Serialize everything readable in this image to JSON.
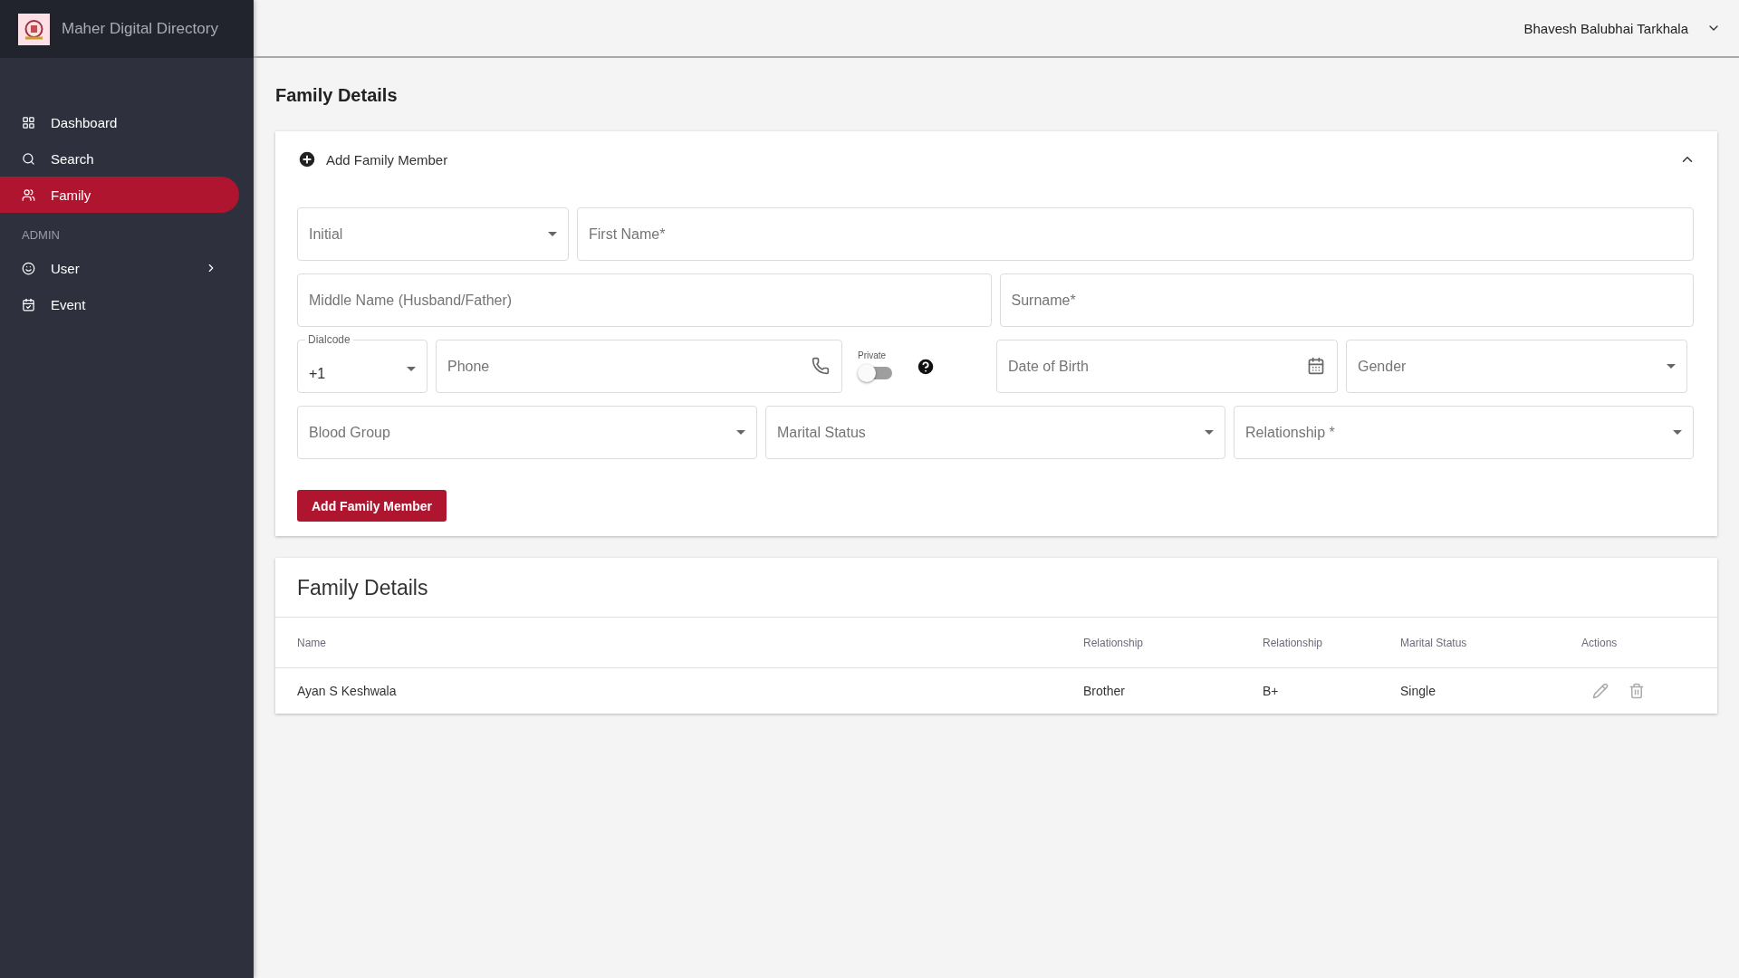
{
  "app": {
    "title": "Maher Digital Directory"
  },
  "sidebar": {
    "items": [
      {
        "label": "Dashboard",
        "selected": false
      },
      {
        "label": "Search",
        "selected": false
      },
      {
        "label": "Family",
        "selected": true
      }
    ],
    "section": "ADMIN",
    "admin_items": [
      {
        "label": "User",
        "selected": false,
        "has_submenu": true
      },
      {
        "label": "Event",
        "selected": false,
        "has_submenu": false
      }
    ]
  },
  "header": {
    "user": "Bhavesh Balubhai Tarkhala"
  },
  "page_title": "Family Details",
  "form": {
    "title": "Add Family Member",
    "expanded": true,
    "fields": [
      {
        "kind": "select",
        "placeholder": "Initial"
      },
      {
        "kind": "text",
        "placeholder": "First Name*"
      },
      {
        "kind": "text",
        "placeholder": "Middle Name (Husband/Father)"
      },
      {
        "kind": "text",
        "placeholder": "Surname*"
      },
      {
        "kind": "dialcode",
        "label": "Dialcode",
        "value": "+1"
      },
      {
        "kind": "phone",
        "placeholder": "Phone"
      },
      {
        "kind": "toggle",
        "label": "Private",
        "on": false
      },
      {
        "kind": "date",
        "placeholder": "Date of Birth"
      },
      {
        "kind": "select",
        "placeholder": "Gender"
      },
      {
        "kind": "select",
        "placeholder": "Blood Group"
      },
      {
        "kind": "select",
        "placeholder": "Marital Status"
      },
      {
        "kind": "select",
        "placeholder": "Relationship *"
      }
    ],
    "submit": "Add Family Member"
  },
  "table": {
    "title": "Family Details",
    "columns": [
      "Name",
      "Relationship",
      "Relationship",
      "Marital Status",
      "Actions"
    ],
    "rows": [
      {
        "cells": [
          "Ayan S Keshwala",
          "Brother",
          "B+",
          "Single"
        ]
      }
    ]
  }
}
